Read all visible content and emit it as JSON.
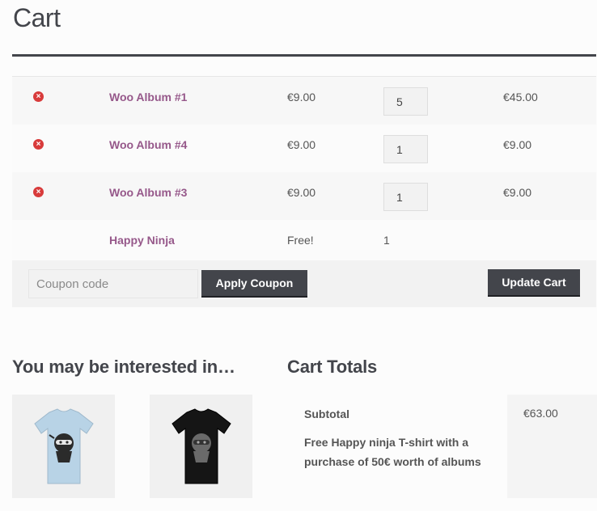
{
  "page": {
    "title": "Cart"
  },
  "cart": {
    "items": [
      {
        "name": "Woo Album #1",
        "price": "€9.00",
        "quantity": "5",
        "subtotal": "€45.00",
        "removable": true
      },
      {
        "name": "Woo Album #4",
        "price": "€9.00",
        "quantity": "1",
        "subtotal": "€9.00",
        "removable": true
      },
      {
        "name": "Woo Album #3",
        "price": "€9.00",
        "quantity": "1",
        "subtotal": "€9.00",
        "removable": true
      },
      {
        "name": "Happy Ninja",
        "price": "Free!",
        "quantity": "1",
        "subtotal": "",
        "removable": false
      }
    ],
    "remove_icon": "remove-circle-icon"
  },
  "actions": {
    "coupon_placeholder": "Coupon code",
    "apply_label": "Apply Coupon",
    "update_label": "Update Cart"
  },
  "cross_sells": {
    "heading": "You may be interested in…",
    "products": [
      {
        "image": "light-blue-ninja-tshirt",
        "shirt_color": "#b8d3e6"
      },
      {
        "image": "black-ninja-tshirt",
        "shirt_color": "#151515"
      }
    ]
  },
  "totals": {
    "heading": "Cart Totals",
    "subtotal_label": "Subtotal",
    "subtotal_value": "€63.00",
    "promo_label": "Free Happy ninja T-shirt with a purchase of 50€ worth of albums"
  },
  "colors": {
    "accent": "#96588a",
    "button": "#43454b",
    "remove": "#d83b3b"
  }
}
